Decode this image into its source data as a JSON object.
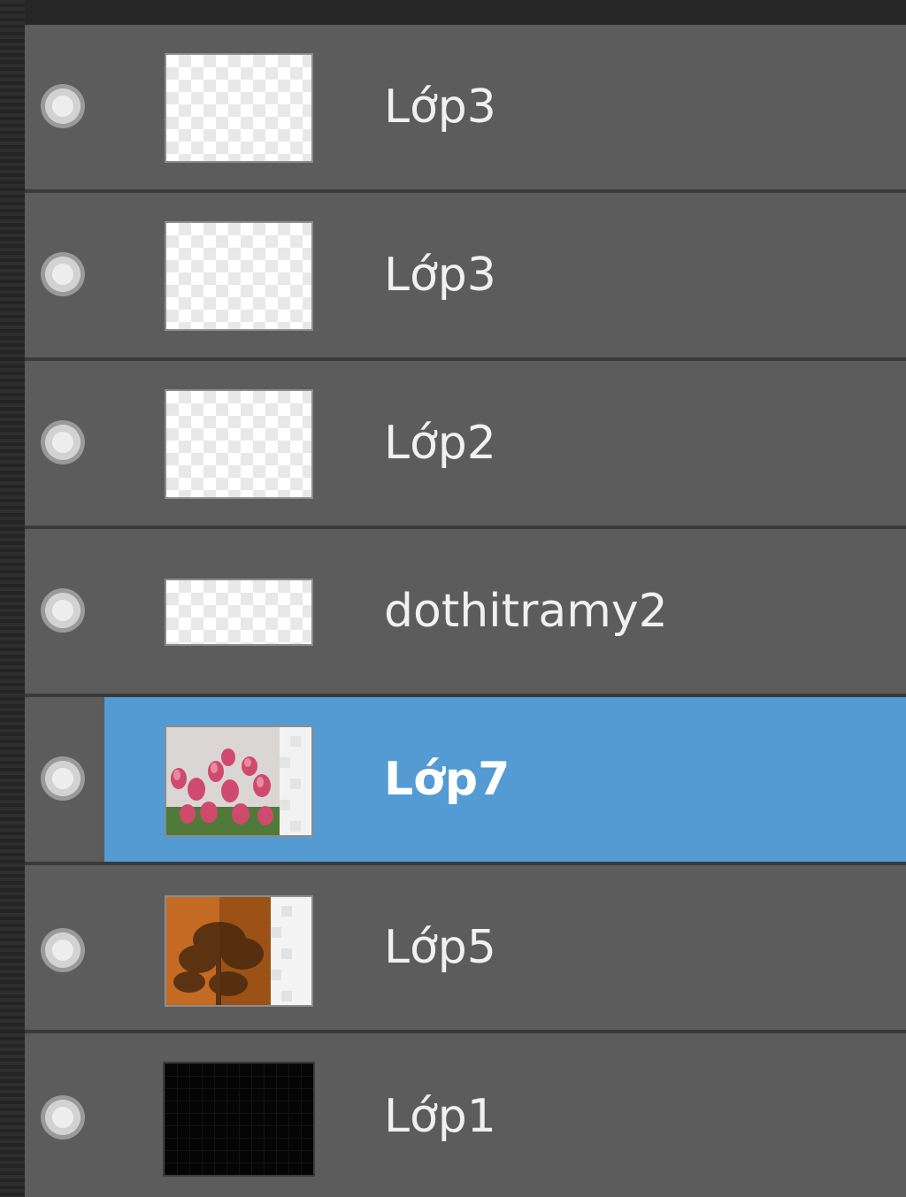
{
  "panel": {
    "title": "",
    "selected_index": 4
  },
  "layers": [
    {
      "name": "Lớp3",
      "thumbnail": "transparent-checker",
      "visible": true
    },
    {
      "name": "Lớp3",
      "thumbnail": "transparent-checker",
      "visible": true
    },
    {
      "name": "Lớp2",
      "thumbnail": "transparent-checker",
      "visible": true
    },
    {
      "name": "dothitramy2",
      "thumbnail": "transparent-checker-wide",
      "visible": true
    },
    {
      "name": "Lớp7",
      "thumbnail": "tulip-photo",
      "visible": true,
      "selected": true
    },
    {
      "name": "Lớp5",
      "thumbnail": "orange-tree-photo",
      "visible": true
    },
    {
      "name": "Lớp1",
      "thumbnail": "black-fill",
      "visible": true
    }
  ],
  "colors": {
    "row_bg": "#5c5c5c",
    "selected_bg": "#539bd2",
    "divider": "#3a3a3a",
    "text": "#f0f0f0"
  },
  "icons": {
    "visibility": "visibility-dot-icon"
  }
}
